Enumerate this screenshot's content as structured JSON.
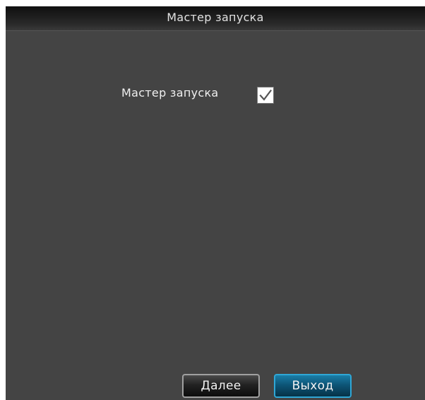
{
  "window": {
    "title": "Мастер запуска"
  },
  "option": {
    "label": "Мастер запуска",
    "checked": true
  },
  "buttons": {
    "next_label": "Далее",
    "exit_label": "Выход"
  },
  "colors": {
    "background": "#444444",
    "titlebar": "#1f1f1f",
    "exit_button_accent": "#0d5577",
    "checkbox_fill": "#ffffff",
    "check_mark": "#555555"
  }
}
